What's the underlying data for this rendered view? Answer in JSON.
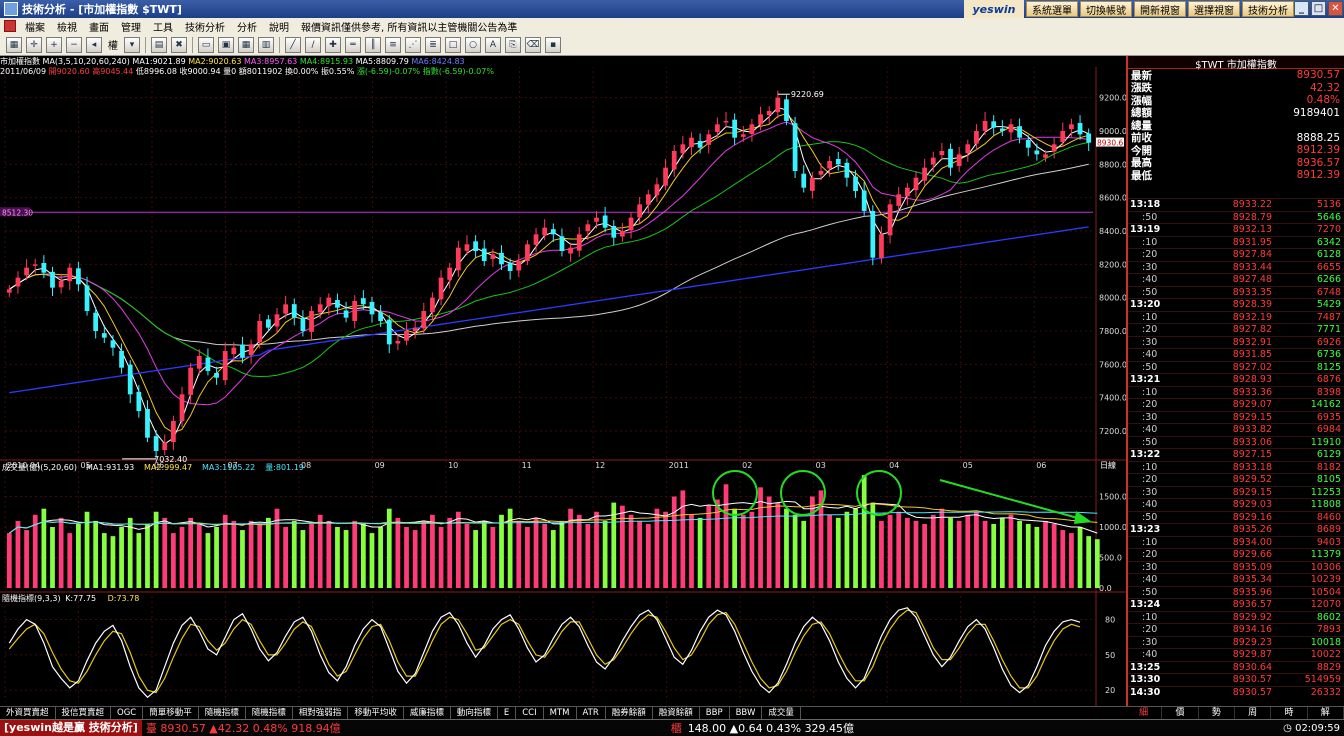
{
  "window": {
    "title": "技術分析 - [市加權指數 $TWT]",
    "brand": "yeswin",
    "top_buttons": [
      "系統選單",
      "切換帳號",
      "開新視窗",
      "選擇視窗",
      "技術分析"
    ]
  },
  "menu": [
    "檔案",
    "檢視",
    "畫面",
    "管理",
    "工具",
    "技術分析",
    "分析",
    "說明",
    "報價資訊僅供參考, 所有資訊以主管機關公告為準"
  ],
  "toolbar": {
    "label_weight": "權"
  },
  "info": {
    "line1": [
      {
        "text": "市加權指數",
        "color": "c-wht"
      },
      {
        "text": "MA(3,5,10,20,60,240)",
        "color": "c-wht"
      },
      {
        "text": "MA1:9021.89",
        "color": "c-wht"
      },
      {
        "text": "MA2:9020.63",
        "color": "c-yel"
      },
      {
        "text": "MA3:8957.63",
        "color": "c-mag"
      },
      {
        "text": "MA4:8915.93",
        "color": "c-green"
      },
      {
        "text": "MA5:8809.79",
        "color": "c-wht"
      },
      {
        "text": "MA6:8424.83",
        "color": "c-blu"
      }
    ],
    "line2": [
      {
        "text": "2011/06/09",
        "color": "c-wht"
      },
      {
        "text": "開9020.60",
        "color": "c-red"
      },
      {
        "text": "高9045.44",
        "color": "c-red"
      },
      {
        "text": "低8996.08",
        "color": "c-wht"
      },
      {
        "text": "收9000.94",
        "color": "c-wht"
      },
      {
        "text": "量0",
        "color": "c-wht"
      },
      {
        "text": "額8011902",
        "color": "c-wht"
      },
      {
        "text": "換0.00%",
        "color": "c-wht"
      },
      {
        "text": "振0.55%",
        "color": "c-wht"
      },
      {
        "text": "漲(-6.59)-0.07%",
        "color": "c-green"
      },
      {
        "text": "指數(-6.59)-0.07%",
        "color": "c-green"
      }
    ]
  },
  "chart_data": {
    "type": "candlestick",
    "price_axis": {
      "ticks": [
        "9200.0",
        "9000.0",
        "8800.0",
        "8600.0",
        "8400.0",
        "8200.0",
        "8000.0",
        "7800.0",
        "7600.0",
        "7400.0",
        "7200.0"
      ],
      "ylim": [
        7050,
        9330
      ]
    },
    "current_price_label": "8930.6",
    "hline_label": "8512.30",
    "annotations": [
      {
        "label": "9220.69"
      },
      {
        "label": "7032.40"
      }
    ],
    "date_axis": [
      "2010 04",
      "05",
      "06",
      "07",
      "08",
      "09",
      "10",
      "11",
      "12",
      "2011",
      "02",
      "03",
      "04",
      "05",
      "06"
    ],
    "date_axis_right_label": "日線",
    "volume_panel": {
      "title": "成交量(億)(5,20,60)",
      "ma1": "MA1:931.93",
      "ma2": "MA2:999.47",
      "ma3": "MA3:1105.22",
      "vol": "量:801.19",
      "ticks": [
        "1500.0",
        "1000.0",
        "500.0",
        "0.0"
      ],
      "ylim": [
        0,
        2000
      ]
    },
    "kd_panel": {
      "title": "隨機指標(9,3,3)",
      "k": "K:77.75",
      "d": "D:73.78",
      "ticks": [
        "80",
        "50",
        "20"
      ],
      "ylim": [
        10,
        100
      ]
    },
    "close_series": [
      8050,
      8120,
      8180,
      8200,
      8150,
      8060,
      8100,
      8180,
      8080,
      7920,
      7800,
      7760,
      7700,
      7580,
      7420,
      7320,
      7160,
      7080,
      7130,
      7260,
      7420,
      7580,
      7650,
      7560,
      7520,
      7680,
      7700,
      7640,
      7720,
      7860,
      7820,
      7900,
      7960,
      7880,
      7800,
      7920,
      7960,
      8000,
      7940,
      7880,
      7980,
      7960,
      7900,
      7860,
      7720,
      7740,
      7800,
      7820,
      7920,
      8000,
      8120,
      8180,
      8300,
      8320,
      8280,
      8220,
      8260,
      8200,
      8160,
      8220,
      8320,
      8380,
      8420,
      8380,
      8280,
      8300,
      8380,
      8440,
      8480,
      8420,
      8360,
      8400,
      8480,
      8560,
      8620,
      8680,
      8780,
      8880,
      8920,
      8960,
      8900,
      8980,
      9040,
      9060,
      8960,
      8980,
      9040,
      9100,
      9120,
      9200,
      9060,
      8760,
      8660,
      8720,
      8760,
      8820,
      8800,
      8720,
      8640,
      8520,
      8240,
      8380,
      8560,
      8620,
      8660,
      8720,
      8780,
      8840,
      8880,
      8780,
      8860,
      8920,
      9000,
      9060,
      9020,
      9000,
      9040,
      8960,
      8900,
      8860,
      8860,
      8920,
      9000,
      9040,
      8980,
      8930
    ],
    "volume_series": [
      900,
      1100,
      950,
      1200,
      1300,
      1000,
      1150,
      900,
      1050,
      1250,
      1100,
      900,
      850,
      1000,
      1150,
      900,
      1050,
      1250,
      1150,
      900,
      1000,
      1150,
      1050,
      900,
      1000,
      1200,
      1100,
      950,
      1100,
      1050,
      1150,
      1300,
      1000,
      1100,
      950,
      1050,
      1200,
      1100,
      1000,
      950,
      1100,
      1050,
      900,
      1000,
      1300,
      1150,
      1000,
      950,
      1100,
      1200,
      1000,
      1150,
      1250,
      1050,
      950,
      1100,
      1000,
      1200,
      1300,
      1100,
      1000,
      1150,
      1050,
      950,
      1100,
      1300,
      1200,
      1050,
      1250,
      1100,
      1400,
      1350,
      1200,
      1100,
      1050,
      1300,
      1250,
      1500,
      1600,
      1200,
      1150,
      1350,
      1450,
      1700,
      1300,
      1200,
      1250,
      1650,
      1500,
      1400,
      1300,
      1200,
      1100,
      1500,
      1600,
      1200,
      1150,
      1250,
      1300,
      1850,
      1400,
      1100,
      1200,
      1250,
      1150,
      1100,
      1050,
      1200,
      1300,
      1150,
      1100,
      1200,
      1250,
      1100,
      1050,
      1150,
      1200,
      1100,
      1050,
      1000,
      1100,
      1050,
      950,
      900,
      1000,
      850,
      800
    ],
    "k_series": [
      60,
      72,
      80,
      76,
      60,
      40,
      30,
      22,
      28,
      45,
      60,
      70,
      75,
      62,
      40,
      22,
      14,
      20,
      40,
      60,
      75,
      82,
      70,
      55,
      50,
      65,
      80,
      85,
      72,
      55,
      45,
      52,
      66,
      78,
      82,
      70,
      50,
      35,
      28,
      40,
      58,
      72,
      80,
      74,
      55,
      36,
      26,
      34,
      52,
      70,
      82,
      86,
      76,
      60,
      48,
      58,
      72,
      80,
      84,
      72,
      56,
      44,
      50,
      64,
      76,
      82,
      74,
      58,
      44,
      38,
      48,
      62,
      74,
      84,
      88,
      80,
      64,
      48,
      42,
      54,
      70,
      82,
      88,
      84,
      70,
      52,
      36,
      24,
      18,
      26,
      42,
      60,
      74,
      82,
      76,
      62,
      44,
      30,
      22,
      30,
      48,
      66,
      80,
      88,
      90,
      82,
      66,
      50,
      40,
      48,
      62,
      74,
      80,
      72,
      56,
      38,
      24,
      18,
      24,
      40,
      58,
      70,
      78,
      80,
      77.75
    ],
    "d_series": [
      55,
      64,
      72,
      76,
      68,
      52,
      38,
      28,
      26,
      36,
      50,
      62,
      70,
      68,
      52,
      32,
      20,
      18,
      30,
      48,
      64,
      76,
      74,
      62,
      54,
      60,
      72,
      80,
      76,
      62,
      50,
      50,
      60,
      72,
      78,
      74,
      58,
      42,
      32,
      36,
      50,
      64,
      74,
      76,
      62,
      44,
      32,
      32,
      46,
      62,
      76,
      82,
      80,
      68,
      54,
      56,
      66,
      76,
      80,
      76,
      62,
      50,
      48,
      58,
      70,
      78,
      78,
      64,
      50,
      42,
      46,
      56,
      68,
      78,
      84,
      82,
      70,
      56,
      46,
      50,
      62,
      76,
      84,
      86,
      76,
      60,
      44,
      30,
      22,
      24,
      36,
      52,
      66,
      76,
      78,
      68,
      52,
      38,
      28,
      28,
      40,
      58,
      72,
      82,
      88,
      86,
      72,
      56,
      46,
      46,
      56,
      68,
      76,
      76,
      62,
      46,
      32,
      22,
      22,
      32,
      48,
      62,
      72,
      76,
      73.78
    ]
  },
  "quote": {
    "header": "$TWT 市加權指數",
    "rows": [
      {
        "label": "最新",
        "value": "8930.57",
        "white": false
      },
      {
        "label": "漲跌",
        "value": "42.32",
        "white": false
      },
      {
        "label": "漲幅",
        "value": "0.48%",
        "white": false
      },
      {
        "label": "總額",
        "value": "9189401",
        "white": true
      },
      {
        "label": "總量",
        "value": "",
        "white": true
      },
      {
        "label": "前收",
        "value": "8888.25",
        "white": true
      },
      {
        "label": "今開",
        "value": "8912.39",
        "white": false
      },
      {
        "label": "最高",
        "value": "8936.57",
        "white": false
      },
      {
        "label": "最低",
        "value": "8912.39",
        "white": false
      }
    ],
    "ticks": [
      {
        "t": "13:18",
        "main": true,
        "p": "8933.22",
        "v": "5136",
        "c": "r"
      },
      {
        "t": ":50",
        "main": false,
        "p": "8928.79",
        "v": "5646",
        "c": "g"
      },
      {
        "t": "13:19",
        "main": true,
        "p": "8932.13",
        "v": "7270",
        "c": "r"
      },
      {
        "t": ":10",
        "main": false,
        "p": "8931.95",
        "v": "6342",
        "c": "g"
      },
      {
        "t": ":20",
        "main": false,
        "p": "8927.84",
        "v": "6128",
        "c": "g"
      },
      {
        "t": ":30",
        "main": false,
        "p": "8933.44",
        "v": "6655",
        "c": "r"
      },
      {
        "t": ":40",
        "main": false,
        "p": "8927.48",
        "v": "6266",
        "c": "g"
      },
      {
        "t": ":50",
        "main": false,
        "p": "8933.35",
        "v": "6748",
        "c": "r"
      },
      {
        "t": "13:20",
        "main": true,
        "p": "8928.39",
        "v": "5429",
        "c": "g"
      },
      {
        "t": ":10",
        "main": false,
        "p": "8932.19",
        "v": "7487",
        "c": "r"
      },
      {
        "t": ":20",
        "main": false,
        "p": "8927.82",
        "v": "7771",
        "c": "g"
      },
      {
        "t": ":30",
        "main": false,
        "p": "8932.91",
        "v": "6926",
        "c": "r"
      },
      {
        "t": ":40",
        "main": false,
        "p": "8931.85",
        "v": "6736",
        "c": "g"
      },
      {
        "t": ":50",
        "main": false,
        "p": "8927.02",
        "v": "8125",
        "c": "g"
      },
      {
        "t": "13:21",
        "main": true,
        "p": "8928.93",
        "v": "6876",
        "c": "r"
      },
      {
        "t": ":10",
        "main": false,
        "p": "8933.36",
        "v": "8398",
        "c": "r"
      },
      {
        "t": ":20",
        "main": false,
        "p": "8929.07",
        "v": "14162",
        "c": "g"
      },
      {
        "t": ":30",
        "main": false,
        "p": "8929.15",
        "v": "6935",
        "c": "r"
      },
      {
        "t": ":40",
        "main": false,
        "p": "8933.82",
        "v": "6984",
        "c": "r"
      },
      {
        "t": ":50",
        "main": false,
        "p": "8933.06",
        "v": "11910",
        "c": "g"
      },
      {
        "t": "13:22",
        "main": true,
        "p": "8927.15",
        "v": "6129",
        "c": "g"
      },
      {
        "t": ":10",
        "main": false,
        "p": "8933.18",
        "v": "8182",
        "c": "r"
      },
      {
        "t": ":20",
        "main": false,
        "p": "8929.52",
        "v": "8105",
        "c": "g"
      },
      {
        "t": ":30",
        "main": false,
        "p": "8929.15",
        "v": "11253",
        "c": "g"
      },
      {
        "t": ":40",
        "main": false,
        "p": "8929.03",
        "v": "11808",
        "c": "g"
      },
      {
        "t": ":50",
        "main": false,
        "p": "8929.16",
        "v": "8460",
        "c": "r"
      },
      {
        "t": "13:23",
        "main": true,
        "p": "8935.26",
        "v": "8689",
        "c": "r"
      },
      {
        "t": ":10",
        "main": false,
        "p": "8934.00",
        "v": "9403",
        "c": "r"
      },
      {
        "t": ":20",
        "main": false,
        "p": "8929.66",
        "v": "11379",
        "c": "g"
      },
      {
        "t": ":30",
        "main": false,
        "p": "8935.09",
        "v": "10306",
        "c": "r"
      },
      {
        "t": ":40",
        "main": false,
        "p": "8935.34",
        "v": "10239",
        "c": "r"
      },
      {
        "t": ":50",
        "main": false,
        "p": "8935.96",
        "v": "10504",
        "c": "r"
      },
      {
        "t": "13:24",
        "main": true,
        "p": "8936.57",
        "v": "12070",
        "c": "r"
      },
      {
        "t": ":10",
        "main": false,
        "p": "8929.92",
        "v": "8602",
        "c": "g"
      },
      {
        "t": ":20",
        "main": false,
        "p": "8934.16",
        "v": "7893",
        "c": "r"
      },
      {
        "t": ":30",
        "main": false,
        "p": "8929.23",
        "v": "10018",
        "c": "g"
      },
      {
        "t": ":40",
        "main": false,
        "p": "8929.87",
        "v": "10022",
        "c": "r"
      },
      {
        "t": "13:25",
        "main": true,
        "p": "8930.64",
        "v": "8829",
        "c": "r"
      },
      {
        "t": "13:30",
        "main": true,
        "p": "8930.57",
        "v": "514959",
        "c": "r"
      },
      {
        "t": "14:30",
        "main": true,
        "p": "8930.57",
        "v": "26332",
        "c": "r"
      }
    ],
    "tabs": [
      "細",
      "價",
      "勢",
      "周",
      "時",
      "解"
    ]
  },
  "indicator_tabs": [
    "外資買賣超",
    "投信買賣超",
    "OGC",
    "簡單移動平",
    "隨機指標",
    "隨機指標",
    "相對強弱指",
    "移動平均收",
    "威廉指標",
    "動向指標",
    "E",
    "CCI",
    "MTM",
    "ATR",
    "融券餘額",
    "融資餘額",
    "BBP",
    "BBW",
    "成交量"
  ],
  "status": {
    "app": "[yeswin越是贏 技術分析]",
    "index1": "臺 8930.57 ▲42.32 0.48% 918.94億",
    "index2_label": "櫃",
    "index2": "148.00 ▲0.64 0.43% 329.45億",
    "clock": "02:09:59"
  }
}
